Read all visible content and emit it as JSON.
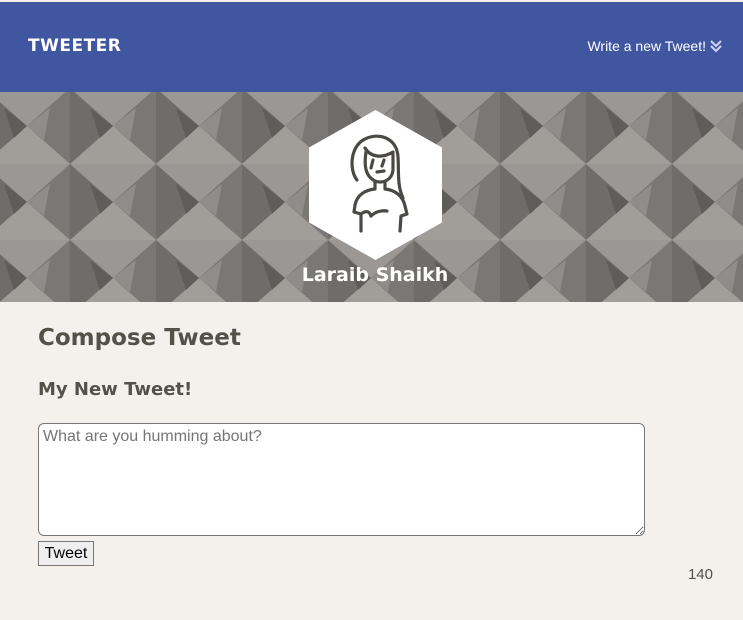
{
  "nav": {
    "brand": "TWEETER",
    "write_link": "Write a new Tweet!",
    "write_icon": "double-chevron-down-icon",
    "background": "#4056a1"
  },
  "profile": {
    "name": "Laraib Shaikh",
    "avatar_icon": "woman-avatar-icon"
  },
  "compose": {
    "title": "Compose Tweet",
    "subtitle": "My New Tweet!",
    "placeholder": "What are you humming about?",
    "value": "",
    "button_label": "Tweet",
    "counter": "140"
  },
  "colors": {
    "page_background": "#f4f1ec",
    "text": "#545149",
    "banner": "#858380"
  }
}
